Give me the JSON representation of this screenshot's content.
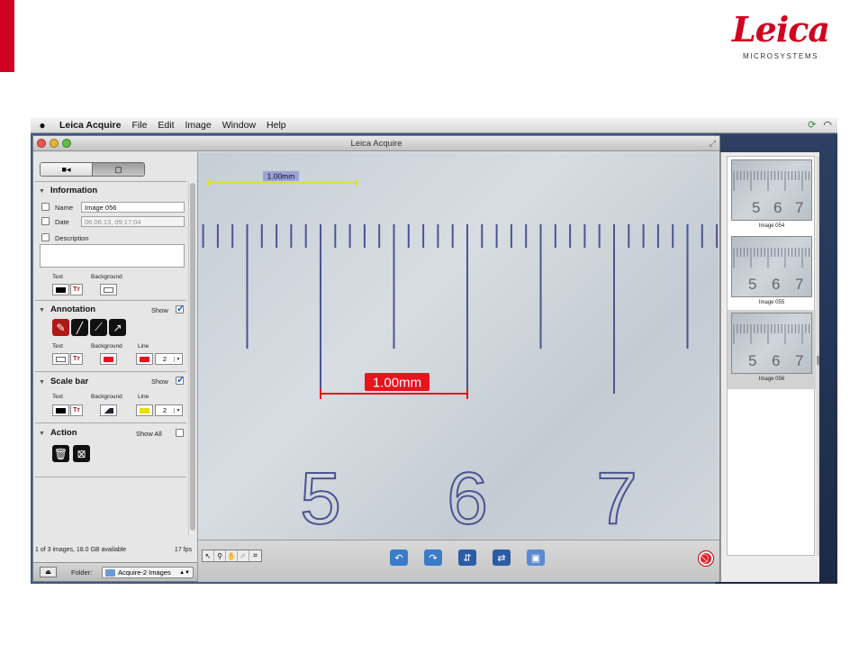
{
  "brand": {
    "name": "Leica",
    "tagline": "MICROSYSTEMS",
    "accent": "#d0001f"
  },
  "menubar": {
    "app": "Leica Acquire",
    "items": [
      "File",
      "Edit",
      "Image",
      "Window",
      "Help"
    ]
  },
  "window": {
    "title": "Leica Acquire"
  },
  "panel": {
    "information": {
      "header": "Information",
      "name_label": "Name",
      "name_value": "Image 056",
      "date_label": "Date",
      "date_value": "06.06.13, 09:17:04",
      "description_label": "Description",
      "text_label": "Text",
      "background_label": "Background"
    },
    "annotation": {
      "header": "Annotation",
      "show_label": "Show",
      "show_checked": true,
      "text_label": "Text",
      "background_label": "Background",
      "line_label": "Line",
      "line_width": "2",
      "tools": [
        "freehand-tool",
        "line-tool",
        "dimension-tool",
        "arrow-tool"
      ]
    },
    "scalebar": {
      "header": "Scale bar",
      "show_label": "Show",
      "show_checked": true,
      "text_label": "Text",
      "background_label": "Background",
      "line_label": "Line",
      "line_width": "2"
    },
    "action": {
      "header": "Action",
      "show_all_label": "Show All",
      "show_all_checked": false
    },
    "status": {
      "summary": "1 of 3 images, 18.0 GB available",
      "fps": "17 fps"
    },
    "folder": {
      "label": "Folder:",
      "value": "Acquire-2 Images"
    }
  },
  "view": {
    "scalebar_label": "1.00mm",
    "annotation_label": "1.00mm",
    "ruler_numbers": [
      "5",
      "6",
      "7"
    ]
  },
  "thumbnails": [
    {
      "caption": "Image 054",
      "selected": false,
      "numbers": [
        "5",
        "6",
        "7"
      ]
    },
    {
      "caption": "Image 055",
      "selected": false,
      "numbers": [
        "5",
        "6",
        "7"
      ]
    },
    {
      "caption": "Image 056",
      "selected": true,
      "numbers": [
        "5",
        "6",
        "7"
      ]
    }
  ],
  "colors": {
    "annotation_red": "#e8141c",
    "scalebar_yellow": "#e8e000",
    "ruler_ink": "#4a5590",
    "checkbox_blue": "#1a58c8"
  }
}
